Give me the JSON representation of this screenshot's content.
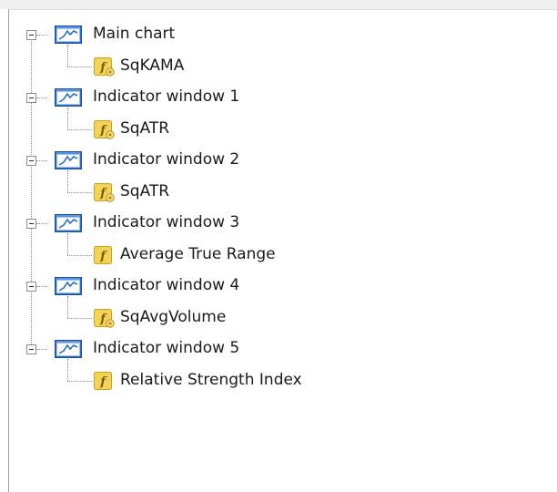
{
  "tree": {
    "groups": [
      {
        "label": "Main chart",
        "child": {
          "label": "SqKAMA",
          "icon": "function-custom-icon"
        }
      },
      {
        "label": "Indicator window 1",
        "child": {
          "label": "SqATR",
          "icon": "function-custom-icon"
        }
      },
      {
        "label": "Indicator window 2",
        "child": {
          "label": "SqATR",
          "icon": "function-custom-icon"
        }
      },
      {
        "label": "Indicator window 3",
        "child": {
          "label": "Average True Range",
          "icon": "function-icon"
        }
      },
      {
        "label": "Indicator window 4",
        "child": {
          "label": "SqAvgVolume",
          "icon": "function-custom-icon"
        }
      },
      {
        "label": "Indicator window 5",
        "child": {
          "label": "Relative Strength Index",
          "icon": "function-icon"
        }
      }
    ]
  },
  "colors": {
    "chart_icon_bg": "#2f6fc4",
    "function_icon_bg": "#f3d35a",
    "function_icon_border": "#c9a21d",
    "tree_line": "#8c8c8c"
  }
}
